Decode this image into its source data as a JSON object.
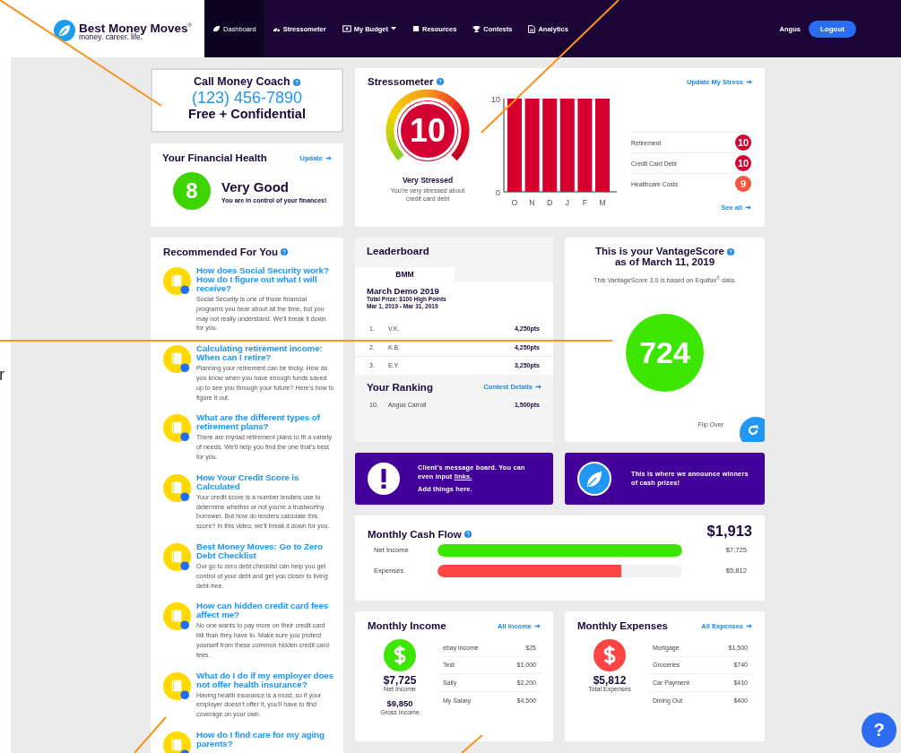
{
  "nav": {
    "brand": "Best Money Moves",
    "brand_mark": "®",
    "tagline": "money. career. life.",
    "items": [
      {
        "label": "Dashboard",
        "selected": true,
        "dropdown": false
      },
      {
        "label": "Stressometer",
        "selected": false,
        "dropdown": false
      },
      {
        "label": "My Budget",
        "selected": false,
        "dropdown": true
      },
      {
        "label": "Resources",
        "selected": false,
        "dropdown": false
      },
      {
        "label": "Contests",
        "selected": false,
        "dropdown": false
      },
      {
        "label": "Analytics",
        "selected": false,
        "dropdown": false
      }
    ],
    "user": "Angus",
    "logout": "Logout"
  },
  "coach": {
    "title": "Call Money Coach",
    "phone": "(123) 456-7890",
    "note": "Free + Confidential"
  },
  "financial_health": {
    "title": "Your Financial Health",
    "link": "Update",
    "score": "8",
    "rating": "Very Good",
    "message": "You are in control of your finances!"
  },
  "recommended": {
    "title": "Recommended For You",
    "items": [
      {
        "title": "How does Social Security work? How do I figure out what I will receive?",
        "text": "Social Security is one of those financial programs you hear about all the time, but you may not really understand. We'll break it down for you."
      },
      {
        "title": "Calculating retirement income: When can I retire?",
        "text": "Planning your retirement can be tricky. How do you know when you have enough funds saved up to see you through your future? Here's how to figure it out."
      },
      {
        "title": "What are the different types of retirement plans?",
        "text": "There are myriad retirement plans to fit a variety of needs. We'll help you find the one that's best for you."
      },
      {
        "title": "How Your Credit Score is Calculated",
        "text": "Your credit score is a number lenders use to determine whether or not you're a trustworthy borrower. But how do lenders calculate this score? In this video, we'll break it down for you."
      },
      {
        "title": "Best Money Moves: Go to Zero Debt Checklist",
        "text": "Our go to zero debt checklist can help you get control of your debt and get you closer to living debt-free."
      },
      {
        "title": "How can hidden credit card fees affect me?",
        "text": "No one wants to pay more on their credit card bill than they have to. Make sure you protect yourself from these common hidden credit card fees."
      },
      {
        "title": "What do I do if my employer does not offer health insurance?",
        "text": "Having health insurance is a must, so if your employer doesn't offer it, you'll have to find coverage on your own."
      },
      {
        "title": "How do I find care for my aging parents?"
      }
    ]
  },
  "stressometer": {
    "title": "Stressometer",
    "link": "Update My Stress",
    "score": "10",
    "status": "Very Stressed",
    "message": "You're very stressed about credit card debt",
    "chart_data": {
      "type": "bar",
      "categories": [
        "O",
        "N",
        "D",
        "J",
        "F",
        "M"
      ],
      "values": [
        10,
        10,
        10,
        10,
        10,
        10
      ],
      "ylim": [
        0,
        10
      ],
      "yticks": [
        0,
        10
      ]
    },
    "categories": [
      {
        "label": "Retirement",
        "score": "10",
        "color": "#d50032"
      },
      {
        "label": "Credit Card Debt",
        "score": "10",
        "color": "#d50032"
      },
      {
        "label": "Healthcare Costs",
        "score": "9",
        "color": "#f4553b"
      }
    ],
    "see_all": "See all"
  },
  "leaderboard": {
    "title": "Leaderboard",
    "tab": "BMM",
    "contest": "March Demo 2019",
    "prize": "Total Prize: $100 High Points",
    "dates": "Mar 1, 2019 - Mar 31, 2019",
    "rows": [
      {
        "rank": "1.",
        "name": "V.K.",
        "points": "4,250pts"
      },
      {
        "rank": "2.",
        "name": "K.B.",
        "points": "4,250pts"
      },
      {
        "rank": "3.",
        "name": "E.Y.",
        "points": "3,250pts"
      }
    ],
    "ranking_title": "Your Ranking",
    "details_link": "Contest Details",
    "my_rank": {
      "rank": "10.",
      "name": "Angus Carroll",
      "points": "1,500pts"
    }
  },
  "vantage": {
    "title": "This is your VantageScore",
    "date": "as of March 11, 2019",
    "note": "This VantageScore 3.0 is based on Equifax$^{®}$ data.",
    "score": "724",
    "flip": "Flip Over"
  },
  "messages": [
    {
      "kind": "alert",
      "text": "Client's message board.  You can even input ",
      "link": "links.",
      "extra": "Add things here."
    },
    {
      "kind": "leaf",
      "text": "This is where we announce winners of cash prizes!"
    }
  ],
  "cash_flow": {
    "title": "Monthly Cash Flow",
    "total": "$1,913",
    "rows": [
      {
        "label": "Net Income",
        "level": 1,
        "value": "$7,725",
        "color": "#3de600"
      },
      {
        "label": "Expenses",
        "level": 0.75,
        "value": "$5,812",
        "color": "#ff4444"
      }
    ]
  },
  "budgets": [
    {
      "title": "Monthly Income",
      "link": "All Income",
      "color": "#3de600",
      "amount": "$7,725",
      "amount_label": "Net Income",
      "secondary": "$9,850",
      "secondary_label": "Gross Income",
      "rows": [
        {
          "label": "ebay income",
          "value": "$25"
        },
        {
          "label": "Test",
          "value": "$1,000"
        },
        {
          "label": "Sally",
          "value": "$2,200"
        },
        {
          "label": "My Salary",
          "value": "$4,500"
        }
      ]
    },
    {
      "title": "Monthly Expenses",
      "link": "All Expenses",
      "color": "#ff4444",
      "amount": "$5,812",
      "amount_label": "Total Expenses",
      "rows": [
        {
          "label": "Mortgage",
          "value": "$1,500"
        },
        {
          "label": "Groceries",
          "value": "$740"
        },
        {
          "label": "Car Payment",
          "value": "$410"
        },
        {
          "label": "Dining Out",
          "value": "$400"
        }
      ]
    }
  ],
  "help_button": "?",
  "edge_text": "r"
}
